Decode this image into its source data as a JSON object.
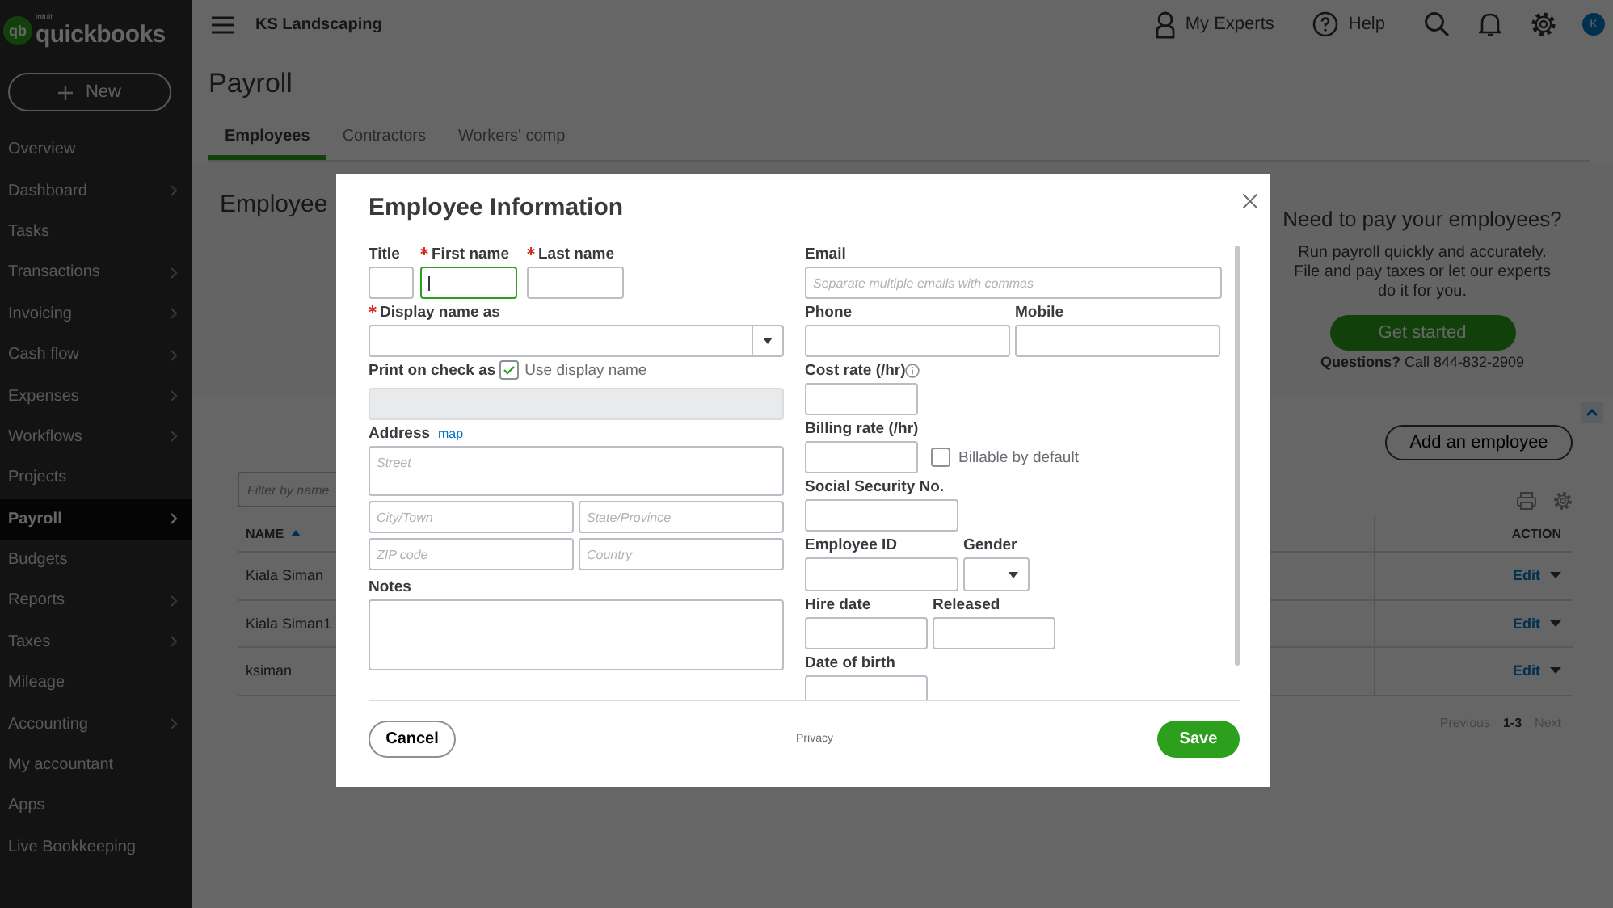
{
  "app": {
    "logo_mark": "qb",
    "logo_small": "intuit",
    "logo": "quickbooks",
    "new_button": "New"
  },
  "sidebar": {
    "items": [
      {
        "label": "Overview",
        "selected": false,
        "has_submenu": false
      },
      {
        "label": "Dashboard",
        "selected": false,
        "has_submenu": true
      },
      {
        "label": "Tasks",
        "selected": false,
        "has_submenu": false
      },
      {
        "label": "Transactions",
        "selected": false,
        "has_submenu": true
      },
      {
        "label": "Invoicing",
        "selected": false,
        "has_submenu": true
      },
      {
        "label": "Cash flow",
        "selected": false,
        "has_submenu": true
      },
      {
        "label": "Expenses",
        "selected": false,
        "has_submenu": true
      },
      {
        "label": "Workflows",
        "selected": false,
        "has_submenu": true
      },
      {
        "label": "Projects",
        "selected": false,
        "has_submenu": false
      },
      {
        "label": "Payroll",
        "selected": true,
        "has_submenu": true
      },
      {
        "label": "Budgets",
        "selected": false,
        "has_submenu": false
      },
      {
        "label": "Reports",
        "selected": false,
        "has_submenu": true
      },
      {
        "label": "Taxes",
        "selected": false,
        "has_submenu": true
      },
      {
        "label": "Mileage",
        "selected": false,
        "has_submenu": false
      },
      {
        "label": "Accounting",
        "selected": false,
        "has_submenu": true
      },
      {
        "label": "My accountant",
        "selected": false,
        "has_submenu": false
      },
      {
        "label": "Apps",
        "selected": false,
        "has_submenu": false
      },
      {
        "label": "Live Bookkeeping",
        "selected": false,
        "has_submenu": false
      }
    ]
  },
  "topbar": {
    "company": "KS Landscaping",
    "links": [
      {
        "kind": "experts",
        "label": "My Experts"
      },
      {
        "kind": "help",
        "label": "Help"
      }
    ],
    "avatar": "K"
  },
  "page": {
    "title": "Payroll",
    "tabs": [
      {
        "label": "Employees",
        "selected": true
      },
      {
        "label": "Contractors",
        "selected": false
      },
      {
        "label": "Workers' comp",
        "selected": false
      }
    ],
    "section_title": "Employee",
    "promo": {
      "title": "Need to pay your employees?",
      "text": "Run payroll quickly and accurately. File and pay taxes or let our experts do it for you.",
      "button": "Get started",
      "questions": "**Questions?** Call 844-832-2909"
    },
    "add_button": "Add an employee",
    "filter": {
      "placeholder": "Filter by name"
    },
    "table": {
      "columns": [
        "NAME",
        "ACTION"
      ],
      "rows": [
        {
          "name": "Kiala Siman",
          "action": "Edit"
        },
        {
          "name": "Kiala Siman1",
          "action": "Edit"
        },
        {
          "name": "ksiman",
          "action": "Edit"
        }
      ]
    },
    "pagination": {
      "previous": {
        "label": "Previous",
        "disabled": true
      },
      "range": "1-3",
      "next": {
        "label": "Next",
        "disabled": true
      }
    }
  },
  "dialog": {
    "title": "Employee Information",
    "name_fields": [
      {
        "label": "Title",
        "required": false,
        "focused": false
      },
      {
        "label": "First name",
        "required": true,
        "focused": true
      },
      {
        "label": "Last name",
        "required": true,
        "focused": false
      }
    ],
    "display_name": {
      "label": "Display name as",
      "required": true
    },
    "print_on_check": {
      "label": "Print on check as",
      "checkbox_label": "Use display name",
      "checked": true
    },
    "address": {
      "label": "Address",
      "link": "map",
      "fields": [
        {
          "placeholder": "Street"
        },
        {
          "placeholder": "City/Town"
        },
        {
          "placeholder": "State/Province"
        },
        {
          "placeholder": "ZIP code"
        },
        {
          "placeholder": "Country"
        }
      ]
    },
    "notes": {
      "label": "Notes"
    },
    "email": {
      "label": "Email",
      "placeholder": "Separate multiple emails with commas"
    },
    "phone": {
      "label": "Phone"
    },
    "mobile": {
      "label": "Mobile"
    },
    "cost_rate": {
      "label": "Cost rate (/hr)"
    },
    "billing_rate": {
      "label": "Billing rate (/hr)",
      "checkbox_label": "Billable by default",
      "checked": false
    },
    "ssn": {
      "label": "Social Security No."
    },
    "employee_id": {
      "label": "Employee ID"
    },
    "gender": {
      "label": "Gender"
    },
    "hire_date": {
      "label": "Hire date"
    },
    "released": {
      "label": "Released"
    },
    "date_of_birth": {
      "label": "Date of birth"
    },
    "buttons": {
      "cancel": "Cancel",
      "privacy": "Privacy",
      "save": "Save"
    }
  }
}
